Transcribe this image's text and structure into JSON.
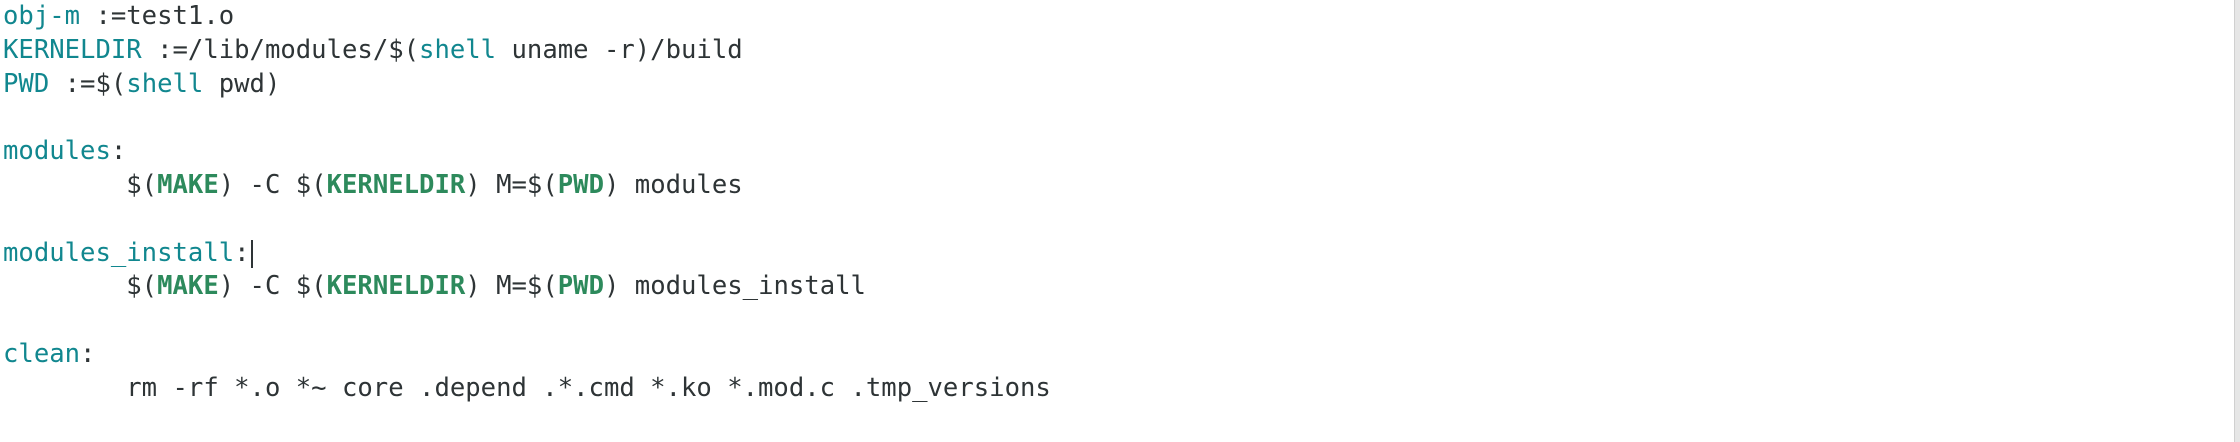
{
  "editor": {
    "lines": [
      {
        "parts": [
          {
            "t": "obj-m",
            "c": "var"
          },
          {
            "t": " :=test1.o",
            "c": ""
          }
        ]
      },
      {
        "parts": [
          {
            "t": "KERNELDIR",
            "c": "var"
          },
          {
            "t": " :=/lib/modules/$(",
            "c": ""
          },
          {
            "t": "shell",
            "c": "kw"
          },
          {
            "t": " uname -r)/build",
            "c": ""
          }
        ]
      },
      {
        "parts": [
          {
            "t": "PWD",
            "c": "var"
          },
          {
            "t": " :=$(",
            "c": ""
          },
          {
            "t": "shell",
            "c": "kw"
          },
          {
            "t": " pwd)",
            "c": ""
          }
        ]
      },
      {
        "parts": []
      },
      {
        "parts": [
          {
            "t": "modules",
            "c": "var"
          },
          {
            "t": ":",
            "c": ""
          }
        ]
      },
      {
        "parts": [
          {
            "t": "        $(",
            "c": ""
          },
          {
            "t": "MAKE",
            "c": "bold"
          },
          {
            "t": ") -C $(",
            "c": ""
          },
          {
            "t": "KERNELDIR",
            "c": "bold"
          },
          {
            "t": ") M=$(",
            "c": ""
          },
          {
            "t": "PWD",
            "c": "bold"
          },
          {
            "t": ") modules",
            "c": ""
          }
        ]
      },
      {
        "parts": []
      },
      {
        "parts": [
          {
            "t": "modules_install",
            "c": "var"
          },
          {
            "t": ":",
            "c": ""
          }
        ],
        "cursor": true
      },
      {
        "parts": [
          {
            "t": "        $(",
            "c": ""
          },
          {
            "t": "MAKE",
            "c": "bold"
          },
          {
            "t": ") -C $(",
            "c": ""
          },
          {
            "t": "KERNELDIR",
            "c": "bold"
          },
          {
            "t": ") M=$(",
            "c": ""
          },
          {
            "t": "PWD",
            "c": "bold"
          },
          {
            "t": ") modules_install",
            "c": ""
          }
        ]
      },
      {
        "parts": []
      },
      {
        "parts": [
          {
            "t": "clean",
            "c": "var"
          },
          {
            "t": ":",
            "c": ""
          }
        ]
      },
      {
        "parts": [
          {
            "t": "        rm -rf *.o *~ core .depend .*.cmd *.ko *.mod.c .tmp_versions",
            "c": ""
          }
        ]
      }
    ]
  },
  "colors": {
    "variable": "#11878f",
    "keyword": "#11878f",
    "bold_ref": "#2d8a5c",
    "text": "#2e3436",
    "background": "#ffffff"
  }
}
